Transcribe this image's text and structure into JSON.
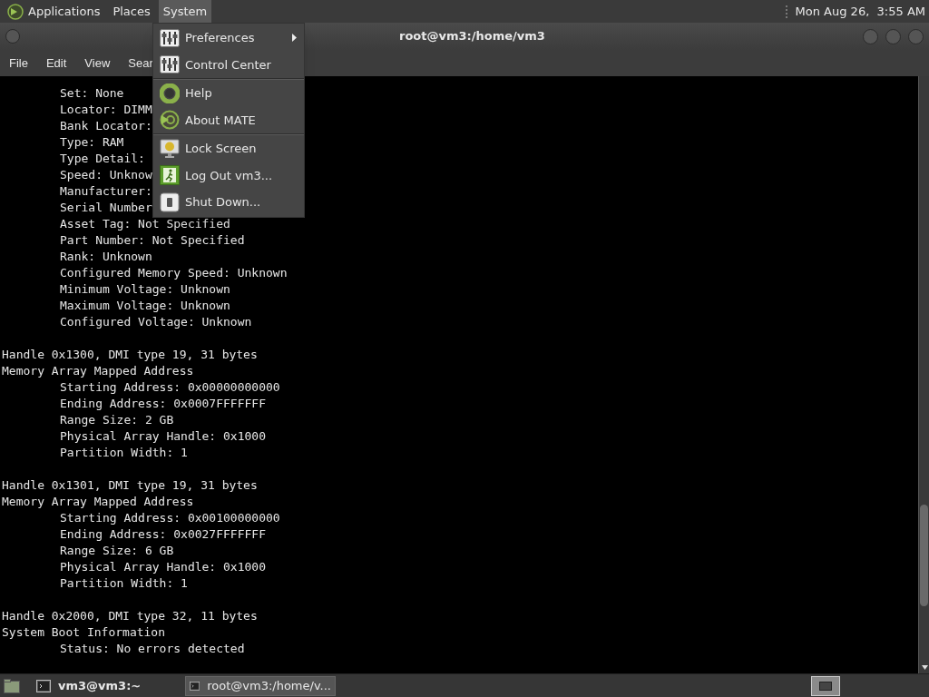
{
  "top_panel": {
    "menus": [
      {
        "label": "Applications",
        "selected": false,
        "kind": "logo"
      },
      {
        "label": "Places",
        "selected": false
      },
      {
        "label": "System",
        "selected": true
      }
    ],
    "clock": "Mon Aug 26,  3:55 AM"
  },
  "window": {
    "title": "root@vm3:/home/vm3"
  },
  "menubar": [
    "File",
    "Edit",
    "View",
    "Sear"
  ],
  "system_menu": {
    "groups": [
      [
        {
          "label": "Preferences",
          "kind": "prefs",
          "submenu": true
        },
        {
          "label": "Control Center",
          "kind": "prefs",
          "submenu": false
        }
      ],
      [
        {
          "label": "Help",
          "kind": "help",
          "submenu": false
        },
        {
          "label": "About MATE",
          "kind": "mate",
          "submenu": false
        }
      ],
      [
        {
          "label": "Lock Screen",
          "kind": "lock",
          "submenu": false
        },
        {
          "label": "Log Out vm3...",
          "kind": "logout",
          "submenu": false
        },
        {
          "label": "Shut Down...",
          "kind": "shutdown",
          "submenu": false
        }
      ]
    ]
  },
  "terminal": {
    "blocks": [
      [
        {
          "text": "Set: None",
          "indented": true
        },
        {
          "text": "Locator: DIMM",
          "indented": true
        },
        {
          "text": "Bank Locator:",
          "indented": true
        },
        {
          "text": "Type: RAM",
          "indented": true
        },
        {
          "text": "Type Detail:",
          "indented": true
        },
        {
          "text": "Speed: Unknow",
          "indented": true
        },
        {
          "text": "Manufacturer:",
          "indented": true
        },
        {
          "text": "Serial Number",
          "indented": true
        },
        {
          "text": "Asset Tag: Not Specified",
          "indented": true
        },
        {
          "text": "Part Number: Not Specified",
          "indented": true
        },
        {
          "text": "Rank: Unknown",
          "indented": true
        },
        {
          "text": "Configured Memory Speed: Unknown",
          "indented": true
        },
        {
          "text": "Minimum Voltage: Unknown",
          "indented": true
        },
        {
          "text": "Maximum Voltage: Unknown",
          "indented": true
        },
        {
          "text": "Configured Voltage: Unknown",
          "indented": true
        }
      ],
      [
        {
          "text": "Handle 0x1300, DMI type 19, 31 bytes",
          "indented": false
        },
        {
          "text": "Memory Array Mapped Address",
          "indented": false
        },
        {
          "text": "Starting Address: 0x00000000000",
          "indented": true
        },
        {
          "text": "Ending Address: 0x0007FFFFFFF",
          "indented": true
        },
        {
          "text": "Range Size: 2 GB",
          "indented": true
        },
        {
          "text": "Physical Array Handle: 0x1000",
          "indented": true
        },
        {
          "text": "Partition Width: 1",
          "indented": true
        }
      ],
      [
        {
          "text": "Handle 0x1301, DMI type 19, 31 bytes",
          "indented": false
        },
        {
          "text": "Memory Array Mapped Address",
          "indented": false
        },
        {
          "text": "Starting Address: 0x00100000000",
          "indented": true
        },
        {
          "text": "Ending Address: 0x0027FFFFFFF",
          "indented": true
        },
        {
          "text": "Range Size: 6 GB",
          "indented": true
        },
        {
          "text": "Physical Array Handle: 0x1000",
          "indented": true
        },
        {
          "text": "Partition Width: 1",
          "indented": true
        }
      ],
      [
        {
          "text": "Handle 0x2000, DMI type 32, 11 bytes",
          "indented": false
        },
        {
          "text": "System Boot Information",
          "indented": false
        },
        {
          "text": "Status: No errors detected",
          "indented": true
        }
      ]
    ]
  },
  "taskbar": {
    "tasks": [
      {
        "label": "vm3@vm3:~",
        "selected": false
      },
      {
        "label": "root@vm3:/home/v...",
        "selected": true
      }
    ]
  }
}
